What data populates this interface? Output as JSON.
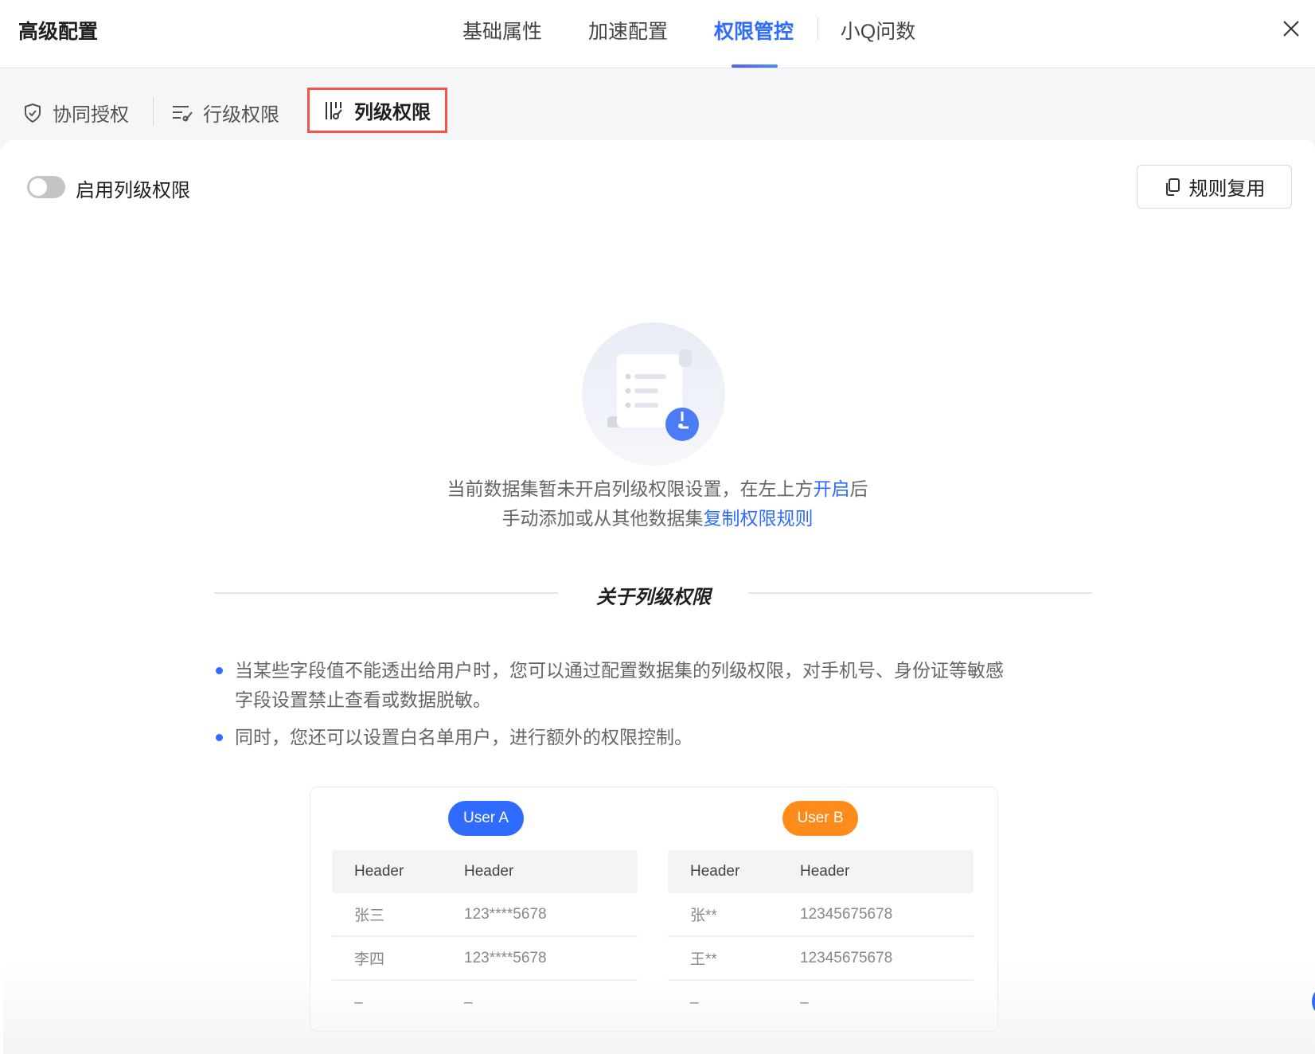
{
  "header": {
    "title": "高级配置",
    "tabs": [
      {
        "label": "基础属性"
      },
      {
        "label": "加速配置"
      },
      {
        "label": "权限管控",
        "active": true
      },
      {
        "label": "小Q问数"
      }
    ]
  },
  "subtabs": [
    {
      "label": "协同授权",
      "icon": "shield-icon"
    },
    {
      "label": "行级权限",
      "icon": "row-filter-icon"
    },
    {
      "label": "列级权限",
      "icon": "column-key-icon",
      "active": true
    }
  ],
  "toolbar": {
    "toggle_label": "启用列级权限",
    "toggle_on": false,
    "reuse_button": "规则复用"
  },
  "empty": {
    "line1_pre": "当前数据集暂未开启列级权限设置，在左上方",
    "line1_link": "开启",
    "line1_post": "后",
    "line2_pre": "手动添加或从其他数据集",
    "line2_link": "复制权限规则"
  },
  "about": {
    "title": "关于列级权限",
    "bullets": [
      "当某些字段值不能透出给用户时，您可以通过配置数据集的列级权限，对手机号、身份证等敏感",
      "字段设置禁止查看或数据脱敏。",
      "同时，您还可以设置白名单用户，进行额外的权限控制。"
    ]
  },
  "example": {
    "userA": {
      "label": "User A",
      "color": "#2f6bff",
      "headers": [
        "Header",
        "Header"
      ],
      "rows": [
        [
          "张三",
          "123****5678"
        ],
        [
          "李四",
          "123****5678"
        ],
        [
          "–",
          "–"
        ]
      ]
    },
    "userB": {
      "label": "User B",
      "color": "#ff8c1a",
      "headers": [
        "Header",
        "Header"
      ],
      "rows": [
        [
          "张**",
          "12345675678"
        ],
        [
          "王**",
          "12345675678"
        ],
        [
          "–",
          "–"
        ]
      ]
    }
  },
  "colors": {
    "accent": "#2f6bff",
    "highlight": "#f5534a"
  }
}
